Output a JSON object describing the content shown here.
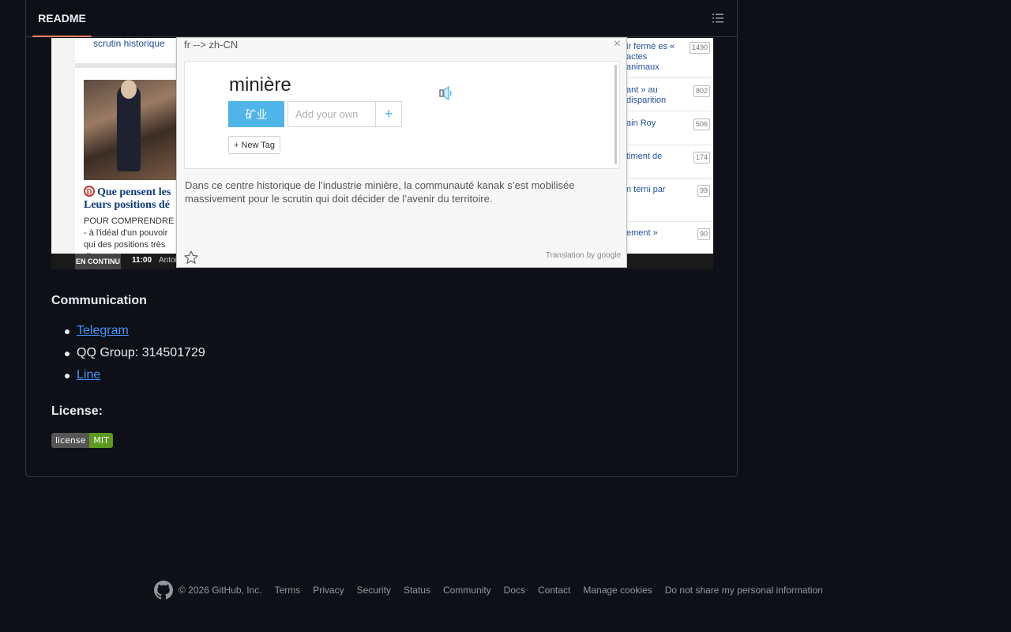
{
  "readme": {
    "tab_label": "README",
    "outline_icon": "list-unordered-icon"
  },
  "screenshot": {
    "article_link": "scrutin historique",
    "headline": "Que pensent les Leurs positions dé",
    "headline_badge": "D",
    "body_text": "POUR COMPRENDRE - à l'idéal d'un pouvoir qui des positions très diverse",
    "bar_label": "EN CONTINU",
    "bar_time": "11:00",
    "bar_author": "Antoi",
    "right_items": [
      {
        "text": "ir fermé es « actes animaux",
        "count": "1490"
      },
      {
        "text": "ant » au disparition",
        "count": "802"
      },
      {
        "text": "ain Roy",
        "count": "506"
      },
      {
        "text": "timent de",
        "count": "174"
      },
      {
        "text": "n terni par",
        "count": "99"
      },
      {
        "text": "ement »",
        "count": "90"
      }
    ]
  },
  "popup": {
    "lang_pair": "fr --> zh-CN",
    "close_glyph": "×",
    "word": "minière",
    "translation": "矿业",
    "add_placeholder": "Add your own",
    "plus_glyph": "+",
    "new_tag": "+ New Tag",
    "sentence": "Dans ce centre historique de l’industrie minière, la communauté kanak s’est mobilisée massivement pour le scrutin qui doit décider de l’avenir du territoire.",
    "credit": "Translation by google"
  },
  "communication": {
    "heading": "Communication",
    "telegram": "Telegram",
    "qq": "QQ Group: 314501729",
    "line": "Line"
  },
  "license": {
    "heading": "License:",
    "badge_left": "license",
    "badge_right": "MIT"
  },
  "footer": {
    "copyright": "© 2026 GitHub, Inc.",
    "links": [
      "Terms",
      "Privacy",
      "Security",
      "Status",
      "Community",
      "Docs",
      "Contact",
      "Manage cookies",
      "Do not share my personal information"
    ]
  },
  "colors": {
    "accent": "#f78166",
    "link": "#4493f8",
    "popup_button": "#4fb4e8"
  }
}
